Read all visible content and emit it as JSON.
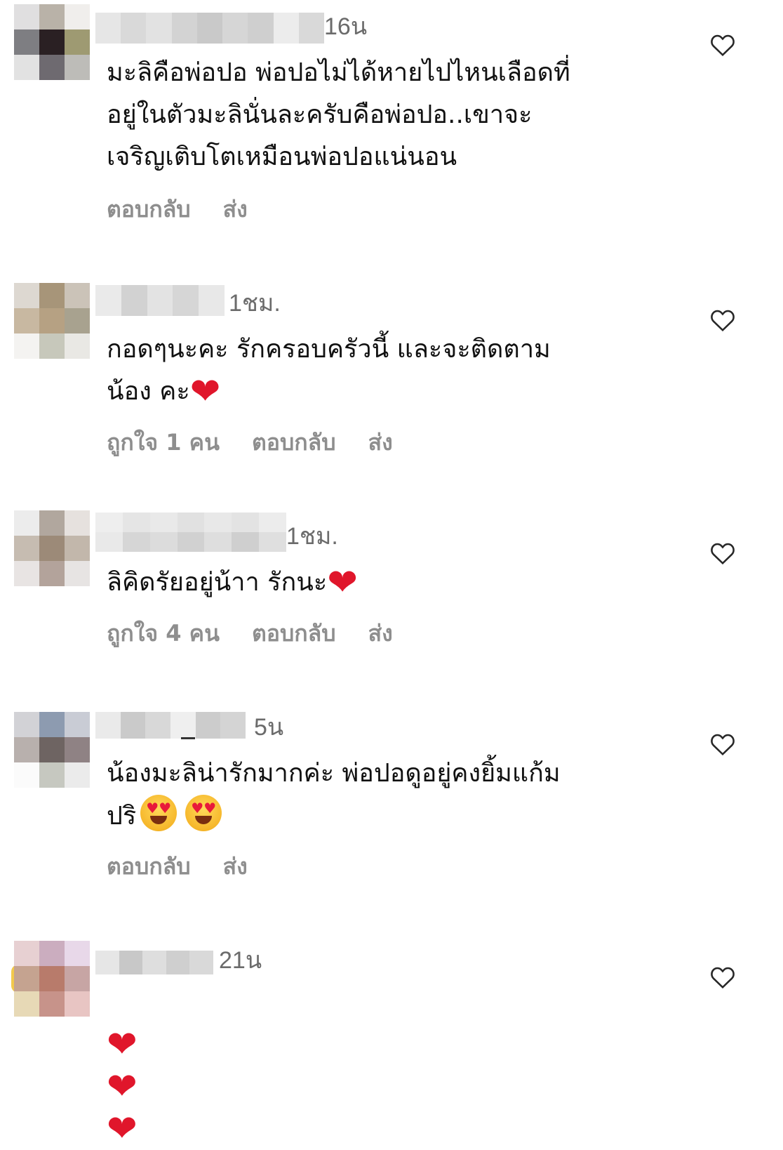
{
  "comments": [
    {
      "time": "16น",
      "text": "มะลิคือพ่อปอ พ่อปอไม่ได้หายไปไหนเลือดที่\nอยู่ในตัวมะลินั่นละครับคือพ่อปอ..เขาจะ\nเจริญเติบโตเหมือนพ่อปอแน่นอน",
      "likes": "",
      "reply": "ตอบกลับ",
      "send": "ส่ง",
      "avatar_colors": [
        "#e0dfe0",
        "#b9b2a8",
        "#f0eeec",
        "#7e7e82",
        "#2a2023",
        "#9e9a72",
        "#e2e2e2",
        "#6e6a70",
        "#bdbcb8"
      ]
    },
    {
      "time": "1ชม.",
      "text": "กอดๆนะคะ รักครอบครัวนี้ และจะติดตาม\nน้อง คะ",
      "emoji": "❤️",
      "likes": "ถูกใจ 1 คน",
      "reply": "ตอบกลับ",
      "send": "ส่ง",
      "avatar_colors": [
        "#ddd8d1",
        "#a79579",
        "#cbc3b8",
        "#c8b8a1",
        "#b6a183",
        "#a8a28f",
        "#f4f3f1",
        "#c7c8bb",
        "#e9e8e4"
      ]
    },
    {
      "time": "1ชม.",
      "text": "ลิคิดรัยอยู่น้าา รักนะ",
      "emoji": "❤️",
      "likes": "ถูกใจ 4 คน",
      "reply": "ตอบกลับ",
      "send": "ส่ง",
      "avatar_colors": [
        "#ececec",
        "#b1a79e",
        "#e6e1de",
        "#c6bcb1",
        "#9c8a78",
        "#c2b7ab",
        "#e8e4e3",
        "#b3a39b",
        "#e7e4e3"
      ]
    },
    {
      "time": "5น",
      "text": "น้องมะลิน่ารักมากค่ะ พ่อปอดูอยู่คงยิ้มแก้ม\nปริ",
      "emoji": "😍 😍",
      "likes": "",
      "reply": "ตอบกลับ",
      "send": "ส่ง",
      "avatar_colors": [
        "#d2d2d6",
        "#8d9bb0",
        "#c9ccd5",
        "#b8b0ad",
        "#6e6462",
        "#8f8284",
        "#fbfbfb",
        "#c6c8c0",
        "#ebebeb"
      ]
    },
    {
      "time": "21น",
      "text": "",
      "emoji": "❤️❤️❤️",
      "likes": "",
      "reply": "",
      "send": "",
      "avatar_colors": [
        "#e7d0d2",
        "#cbadbf",
        "#e8d8e9",
        "#c5a390",
        "#b87b6b",
        "#c7a5a4",
        "#e7d9b6",
        "#c7938a",
        "#e8c5c3"
      ]
    }
  ]
}
